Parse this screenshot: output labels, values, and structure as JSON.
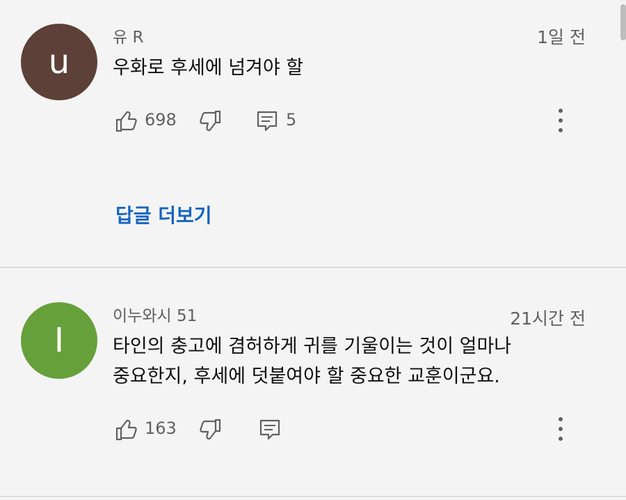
{
  "comments": [
    {
      "author": "유 R",
      "time": "1일 전",
      "avatar_letter": "u",
      "avatar_color": "#5d4037",
      "text_lines": [
        "우화로 후세에 넘겨야 할"
      ],
      "likes": "698",
      "replies_count": "5"
    },
    {
      "author": "이누와시 51",
      "time": "21시간 전",
      "avatar_letter": "I",
      "avatar_color": "#66a03a",
      "text_lines": [
        "타인의 충고에 겸허하게 귀를 기울이는 것이 얼마나",
        "중요한지, 후세에 덧붙여야 할 중요한 교훈이군요."
      ],
      "likes": "163",
      "replies_count": ""
    }
  ],
  "replies_link": "답글 더보기",
  "icons": {
    "like": "thumbs-up-icon",
    "dislike": "thumbs-down-icon",
    "reply": "comment-icon",
    "more": "more-vertical-icon"
  },
  "colors": {
    "link": "#1565c0",
    "background": "#f4f4f4",
    "secondary_text": "#606060"
  }
}
